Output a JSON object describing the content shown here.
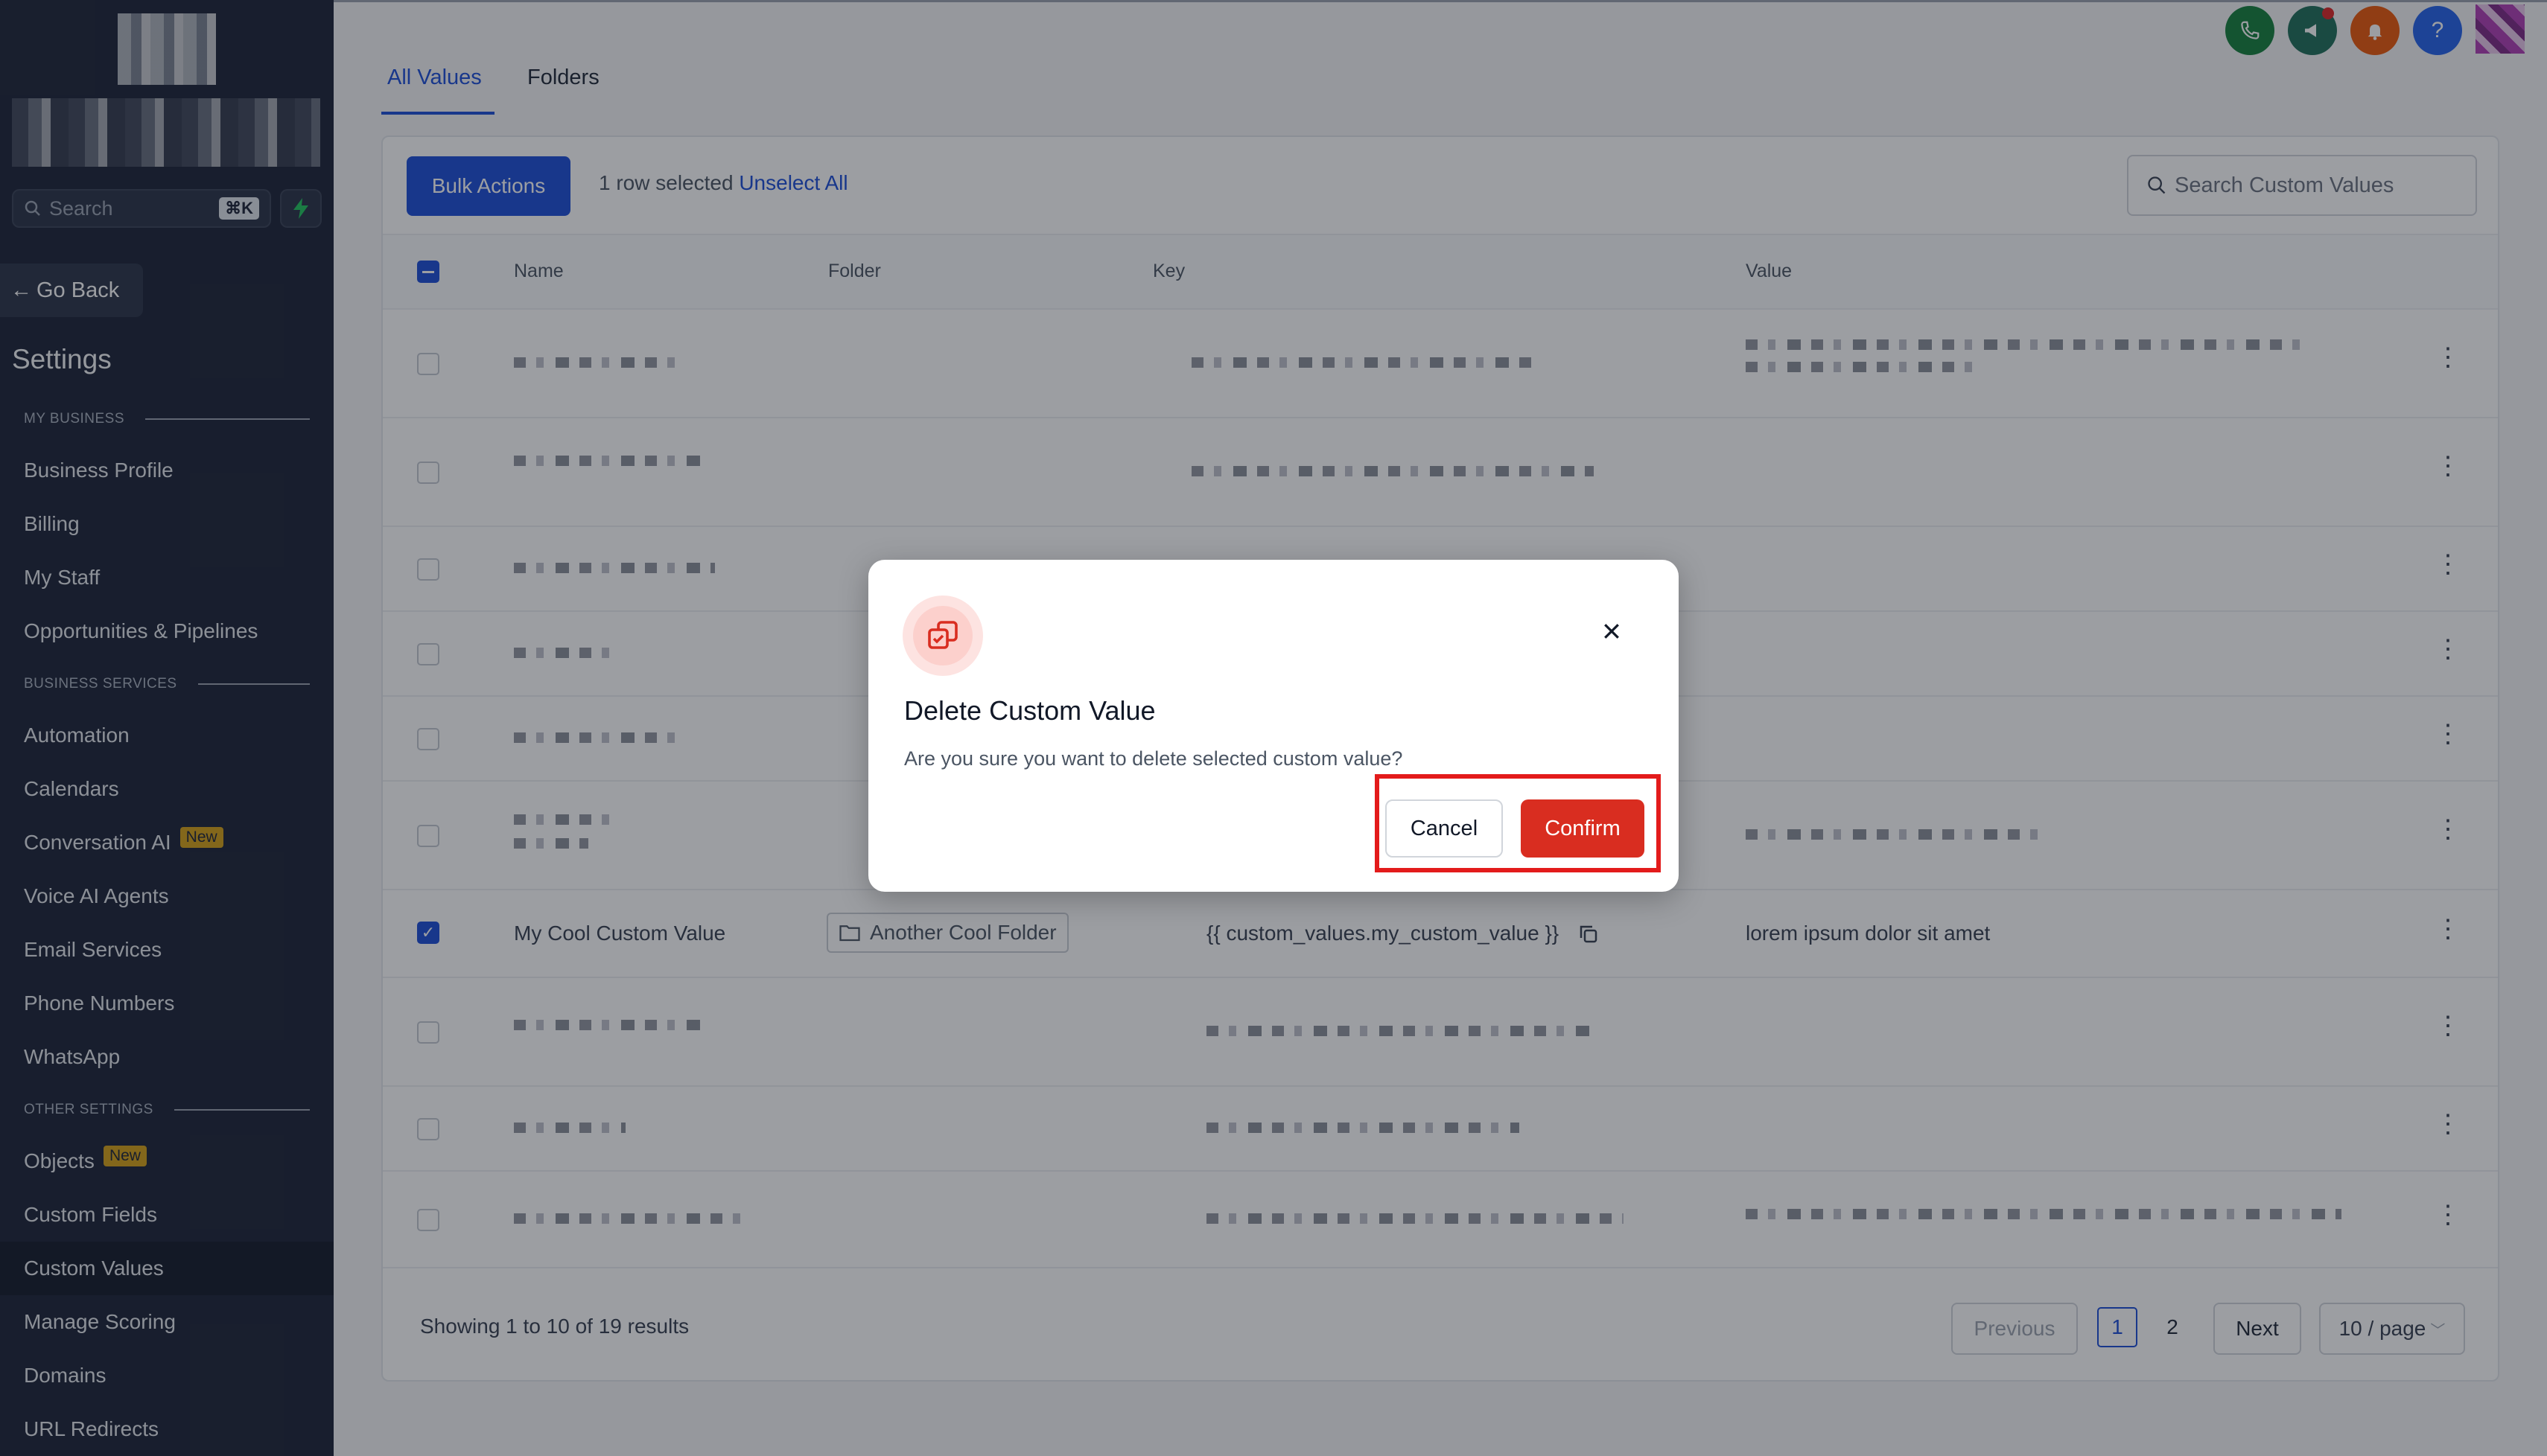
{
  "sidebar": {
    "search_placeholder": "Search",
    "search_shortcut": "⌘K",
    "go_back": "Go Back",
    "title": "Settings",
    "sections": {
      "my_business": "MY BUSINESS",
      "business_services": "BUSINESS SERVICES",
      "other_settings": "OTHER SETTINGS"
    },
    "items": [
      {
        "label": "Business Profile"
      },
      {
        "label": "Billing"
      },
      {
        "label": "My Staff"
      },
      {
        "label": "Opportunities & Pipelines"
      },
      {
        "label": "Automation"
      },
      {
        "label": "Calendars"
      },
      {
        "label": "Conversation AI",
        "badge": "New"
      },
      {
        "label": "Voice AI Agents"
      },
      {
        "label": "Email Services"
      },
      {
        "label": "Phone Numbers"
      },
      {
        "label": "WhatsApp"
      },
      {
        "label": "Objects",
        "badge": "New"
      },
      {
        "label": "Custom Fields"
      },
      {
        "label": "Custom Values",
        "active": true
      },
      {
        "label": "Manage Scoring"
      },
      {
        "label": "Domains"
      },
      {
        "label": "URL Redirects"
      }
    ]
  },
  "tabs": [
    {
      "label": "All Values",
      "active": true
    },
    {
      "label": "Folders",
      "active": false
    }
  ],
  "toolbar": {
    "bulk_actions": "Bulk Actions",
    "selection_text": "1 row selected",
    "unselect_all": "Unselect All",
    "search_placeholder": "Search Custom Values"
  },
  "table": {
    "columns": [
      "Name",
      "Folder",
      "Key",
      "Value"
    ],
    "visible_row": {
      "name": "My Cool Custom Value",
      "folder": "Another Cool Folder",
      "key": "{{ custom_values.my_custom_value }}",
      "value": "lorem ipsum dolor sit amet",
      "checked": true
    }
  },
  "footer": {
    "summary": "Showing 1 to 10 of 19 results",
    "previous": "Previous",
    "pages": [
      "1",
      "2"
    ],
    "current_page": "1",
    "next": "Next",
    "page_size": "10 / page"
  },
  "modal": {
    "title": "Delete Custom Value",
    "description": "Are you sure you want to delete selected custom value?",
    "cancel": "Cancel",
    "confirm": "Confirm"
  },
  "colors": {
    "sidebar_bg": "#1c2437",
    "accent": "#1d4ed8",
    "danger": "#d92d20",
    "highlight": "#e31b1b"
  },
  "icons": [
    "phone-icon",
    "megaphone-icon",
    "bell-icon",
    "help-icon",
    "search-icon",
    "bolt-icon",
    "arrow-left-icon",
    "folder-icon",
    "copy-icon",
    "close-icon",
    "duplicate-delete-icon",
    "kebab-menu-icon"
  ]
}
